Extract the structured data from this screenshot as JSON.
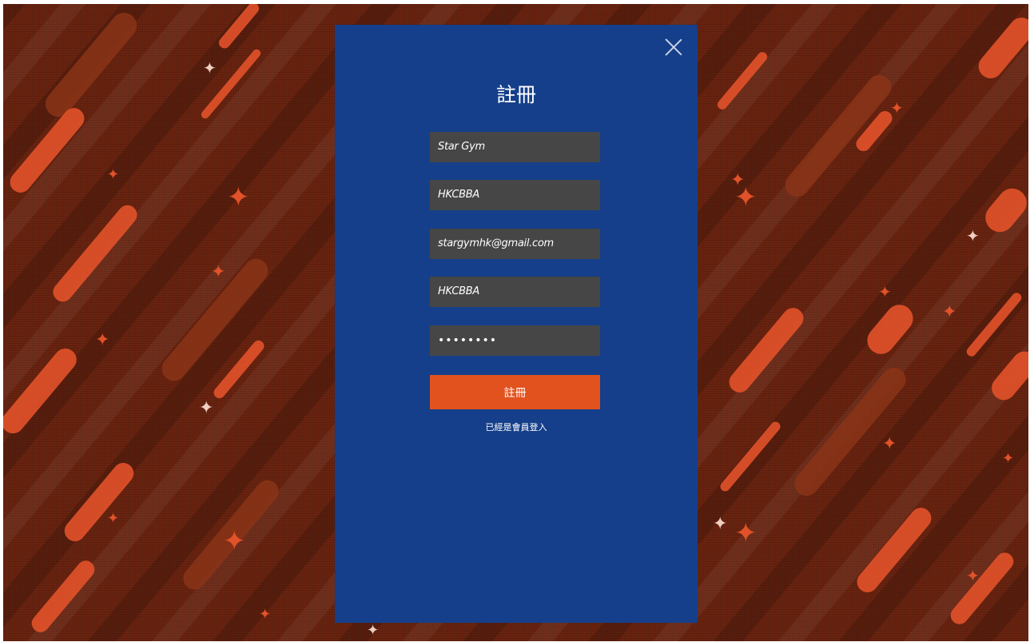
{
  "background": {
    "base_color": "#6a2410",
    "accent_color": "#e2522a"
  },
  "modal": {
    "background_color": "#153f8a",
    "close_icon": "close-icon",
    "title": "註冊",
    "fields": {
      "name_value": "Star Gym",
      "username_value": "HKCBBA",
      "email_value": "stargymhk@gmail.com",
      "nickname_value": "HKCBBA",
      "password_value": "••••••••"
    },
    "submit_label": "註冊",
    "submit_color": "#e2521e",
    "login_link": "已經是會員登入",
    "field_color": "#464646"
  }
}
